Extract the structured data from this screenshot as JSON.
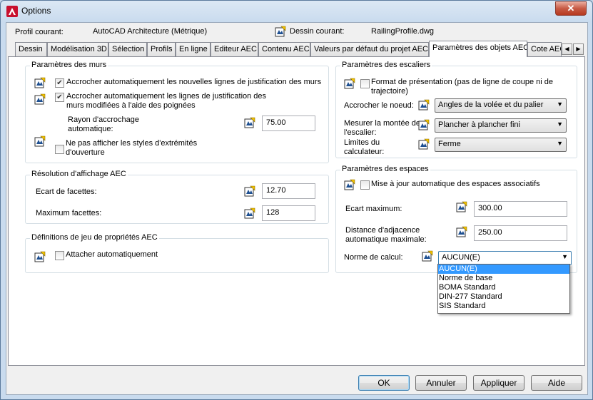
{
  "window": {
    "title": "Options",
    "close_glyph": "✕"
  },
  "profile": {
    "current_label": "Profil courant:",
    "current_value": "AutoCAD Architecture (Métrique)",
    "drawing_label": "Dessin courant:",
    "drawing_value": "RailingProfile.dwg"
  },
  "tabs": [
    {
      "label": "Dessin"
    },
    {
      "label": "Modélisation 3D"
    },
    {
      "label": "Sélection"
    },
    {
      "label": "Profils"
    },
    {
      "label": "En ligne"
    },
    {
      "label": "Editeur AEC"
    },
    {
      "label": "Contenu AEC"
    },
    {
      "label": "Valeurs par défaut du projet AEC"
    },
    {
      "label": "Paramètres des objets AEC",
      "active": true
    },
    {
      "label": "Cote AEC"
    }
  ],
  "walls": {
    "legend": "Paramètres des murs",
    "snap_new": "Accrocher automatiquement les nouvelles lignes de justification des murs",
    "snap_new_checked": true,
    "snap_modified": "Accrocher automatiquement les lignes de justification des murs modifiées à l'aide des poignées",
    "snap_modified_checked": true,
    "snap_radius_label": "Rayon d'accrochage automatique:",
    "snap_radius_value": "75.00",
    "hide_endcap": "Ne pas afficher les styles d'extrémités d'ouverture",
    "hide_endcap_checked": false
  },
  "display": {
    "legend": "Résolution d'affichage AEC",
    "facet_dev_label": "Ecart de facettes:",
    "facet_dev_value": "12.70",
    "max_facets_label": "Maximum facettes:",
    "max_facets_value": "128"
  },
  "propset": {
    "legend": "Définitions de jeu de propriétés AEC",
    "auto_attach": "Attacher automatiquement",
    "auto_attach_checked": false
  },
  "stairs": {
    "legend": "Paramètres des escaliers",
    "presentation": "Format de présentation (pas de ligne de coupe ni de trajectoire)",
    "presentation_checked": false,
    "node_label": "Accrocher le noeud:",
    "node_value": "Angles de la volée et du palier",
    "rise_label": "Mesurer la montée de l'escalier:",
    "rise_value": "Plancher à plancher fini",
    "limits_label": "Limites du calculateur:",
    "limits_value": "Ferme"
  },
  "spaces": {
    "legend": "Paramètres des espaces",
    "auto_update": "Mise à jour automatique des espaces associatifs",
    "auto_update_checked": false,
    "max_gap_label": "Ecart maximum:",
    "max_gap_value": "300.00",
    "max_adj_label": "Distance d'adjacence automatique maximale:",
    "max_adj_value": "250.00",
    "norm_label": "Norme de calcul:",
    "norm_value": "AUCUN(E)",
    "norm_options": [
      "AUCUN(E)",
      "Norme de base",
      "BOMA Standard",
      "DIN-277 Standard",
      "SIS Standard"
    ]
  },
  "buttons": {
    "ok": "OK",
    "cancel": "Annuler",
    "apply": "Appliquer",
    "help": "Aide"
  },
  "icons": {
    "app": "autocad-logo-icon",
    "drawing": "drawing-setting-icon",
    "setting": "drawing-setting-icon"
  },
  "colors": {
    "accent": "#3399ff",
    "app_red": "#c8102e",
    "close_red": "#c75a44"
  }
}
